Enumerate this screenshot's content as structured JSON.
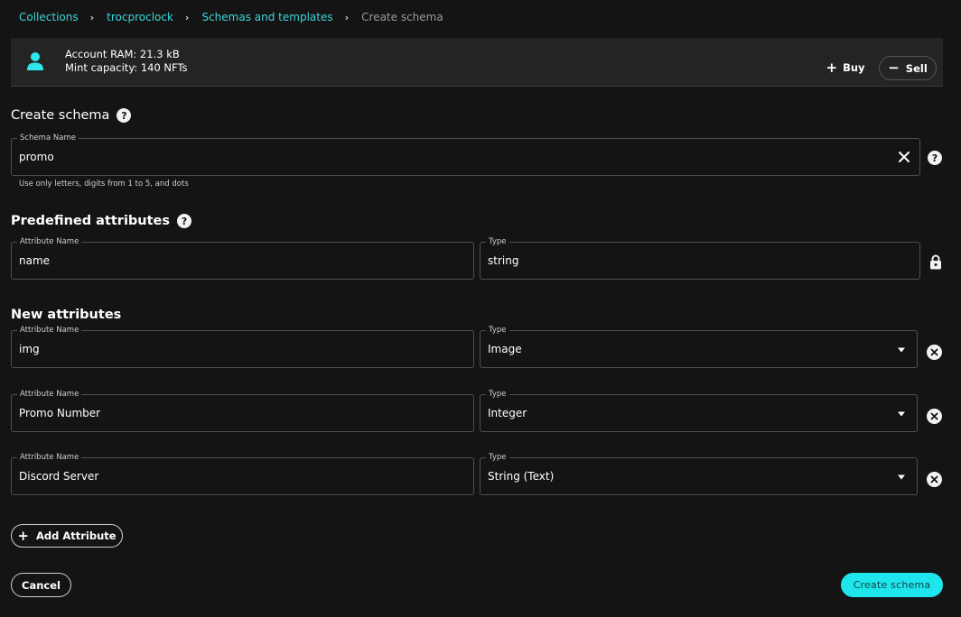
{
  "breadcrumb": {
    "items": [
      "Collections",
      "trocproclock",
      "Schemas and templates"
    ],
    "current": "Create schema"
  },
  "account": {
    "ram": "Account RAM: 21.3 kB",
    "mint": "Mint capacity: 140 NFTs",
    "buy_label": "Buy",
    "sell_label": "Sell"
  },
  "create_section": {
    "title": "Create schema",
    "schema_name_label": "Schema Name",
    "schema_name_value": "promo",
    "helper": "Use only letters, digits from 1 to 5, and dots"
  },
  "predefined": {
    "title": "Predefined attributes",
    "attributes": [
      {
        "name_label": "Attribute Name",
        "name": "name",
        "type_label": "Type",
        "type": "string"
      }
    ]
  },
  "new_attributes": {
    "title": "New attributes",
    "attributes": [
      {
        "name_label": "Attribute Name",
        "name": "img",
        "type_label": "Type",
        "type": "Image"
      },
      {
        "name_label": "Attribute Name",
        "name": "Promo Number",
        "type_label": "Type",
        "type": "Integer"
      },
      {
        "name_label": "Attribute Name",
        "name": "Discord Server",
        "type_label": "Type",
        "type": "String (Text)"
      }
    ]
  },
  "actions": {
    "add_attribute": "Add Attribute",
    "cancel": "Cancel",
    "create": "Create schema"
  },
  "colors": {
    "accent": "#1fe6ec",
    "link": "#3ad6dc",
    "background": "#141414",
    "panel": "#242424"
  },
  "icons": {
    "account": "person-icon",
    "help": "help-icon",
    "clear": "close-icon",
    "lock": "lock-icon",
    "remove": "remove-circle-icon",
    "dropdown": "caret-down-icon",
    "add": "plus-icon",
    "subtract": "minus-icon"
  }
}
